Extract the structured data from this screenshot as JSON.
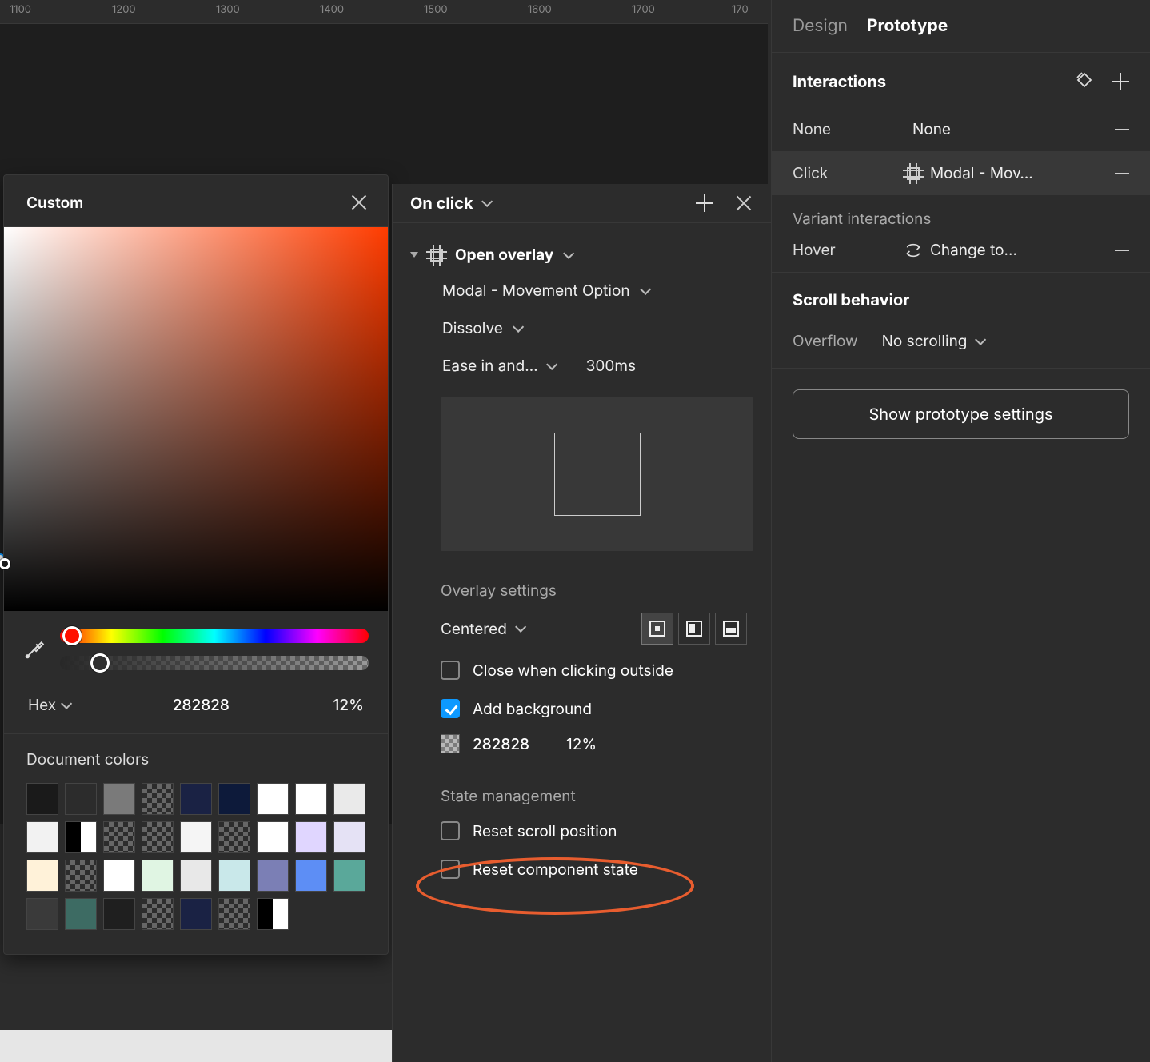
{
  "ruler": {
    "ticks": [
      "1100",
      "1200",
      "1300",
      "1400",
      "1500",
      "1600",
      "1700",
      "170"
    ]
  },
  "color_picker": {
    "title": "Custom",
    "mode_label": "Hex",
    "hex": "282828",
    "opacity": "12%",
    "doc_colors_title": "Document colors"
  },
  "interaction_panel": {
    "trigger": "On click",
    "action": "Open overlay",
    "target": "Modal - Movement Option",
    "animation": "Dissolve",
    "easing": "Ease in and…",
    "duration": "300ms",
    "overlay_title": "Overlay settings",
    "position": "Centered",
    "close_outside": "Close when clicking outside",
    "add_bg": "Add background",
    "bg_hex": "282828",
    "bg_pct": "12%",
    "state_title": "State management",
    "reset_scroll": "Reset scroll position",
    "reset_component": "Reset component state"
  },
  "sidebar": {
    "tab_design": "Design",
    "tab_prototype": "Prototype",
    "interactions_title": "Interactions",
    "row_none_trigger": "None",
    "row_none_action": "None",
    "row_click_trigger": "Click",
    "row_click_action": "Modal - Mov…",
    "variant_title": "Variant interactions",
    "row_hover_trigger": "Hover",
    "row_hover_action": "Change to…",
    "scroll_title": "Scroll behavior",
    "overflow_label": "Overflow",
    "overflow_value": "No scrolling",
    "proto_settings": "Show prototype settings"
  }
}
